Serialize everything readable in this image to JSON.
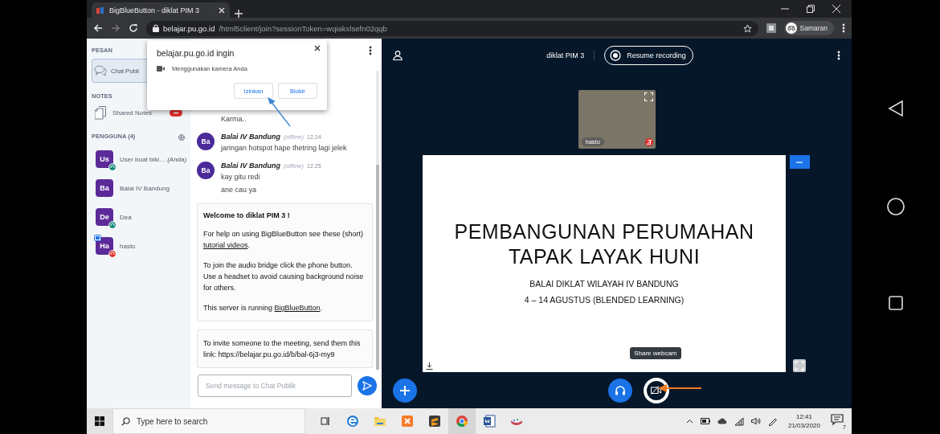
{
  "browser": {
    "tab_title": "BigBlueButton - diklat PIM 3",
    "url_host": "belajar.pu.go.id",
    "url_path": "/html5client/join?sessionToken=wqiakxlsefn02qqb",
    "profile": "Samaran"
  },
  "permission_popup": {
    "title": "belajar.pu.go.id ingin",
    "request": "Menggunakan kamera Anda",
    "buttons": [
      {
        "label": "Izinkan"
      },
      {
        "label": "Blokir"
      }
    ]
  },
  "sidebar": {
    "messages_heading": "PESAN",
    "chats": [
      {
        "label": "Chat Publi",
        "selected": true
      }
    ],
    "notes_heading": "NOTES",
    "notes": [
      {
        "label": "Shared Notes",
        "unread": true
      }
    ],
    "users_heading": "PENGGUNA (4)",
    "users": [
      {
        "initials": "Us",
        "name": "User buat biki…",
        "suffix": "(Anda)",
        "listening": true,
        "muted": false,
        "webcam": false
      },
      {
        "initials": "Ba",
        "name": "Balai IV Bandung",
        "listening": false,
        "muted": false,
        "webcam": false
      },
      {
        "initials": "De",
        "name": "Dea",
        "listening": true,
        "muted": false,
        "webcam": false
      },
      {
        "initials": "Ha",
        "name": "hasto",
        "listening": false,
        "muted": true,
        "webcam": true
      }
    ]
  },
  "chat": {
    "messages": [
      {
        "kind": "continuation",
        "lines": [
          "Karma.."
        ]
      },
      {
        "kind": "message",
        "initials": "Ba",
        "sender": "Balai IV Bandung",
        "status": "(offline)",
        "time": "12.24",
        "lines": [
          "jaringan hotspot hape thetring lagi jelek"
        ]
      },
      {
        "kind": "message",
        "initials": "Ba",
        "sender": "Balai IV Bandung",
        "status": "(offline)",
        "time": "12.25",
        "lines": [
          "kay gitu redi",
          "ane cau ya"
        ]
      }
    ],
    "welcome": [
      {
        "kind": "title",
        "text": "Welcome to diklat PIM 3 !"
      },
      {
        "kind": "text",
        "text": "For help on using BigBlueButton see these (short) ",
        "link": "tutorial videos",
        "after": "."
      },
      {
        "kind": "text",
        "text": "To join the audio bridge click the phone button. Use a headset to avoid causing background noise for others."
      },
      {
        "kind": "text",
        "text": "This server is running ",
        "link": "BigBlueButton",
        "after": "."
      }
    ],
    "invite": "To invite someone to the meeting, send them this link: https://belajar.pu.go.id/b/bal-6j3-my9",
    "input_placeholder": "Send message to Chat Publik"
  },
  "main": {
    "meeting_title": "diklat PIM 3",
    "recording_button": "Resume recording",
    "webcam": {
      "name": "hasto",
      "muted": true
    },
    "slide": {
      "lines": [
        {
          "kind": "title",
          "text": "PEMBANGUNAN PERUMAHAN"
        },
        {
          "kind": "title",
          "text": "TAPAK LAYAK HUNI"
        },
        {
          "kind": "subtitle",
          "text": "BALAI DIKLAT WILAYAH IV BANDUNG"
        },
        {
          "kind": "subtitle",
          "text": "4 – 14 AGUSTUS (BLENDED LEARNING)"
        }
      ]
    },
    "tooltip": "Share webcam"
  },
  "taskbar": {
    "search_placeholder": "Type here to search",
    "apps": [
      {
        "kind": "edge",
        "selected": false
      },
      {
        "kind": "explorer",
        "selected": false
      },
      {
        "kind": "xampp",
        "selected": false
      },
      {
        "kind": "sublime",
        "selected": false
      },
      {
        "kind": "chrome",
        "selected": true
      },
      {
        "kind": "word",
        "selected": false
      },
      {
        "kind": "paint",
        "selected": false
      }
    ],
    "time": "12:41",
    "date": "21/03/2020",
    "notification_count": "7"
  }
}
